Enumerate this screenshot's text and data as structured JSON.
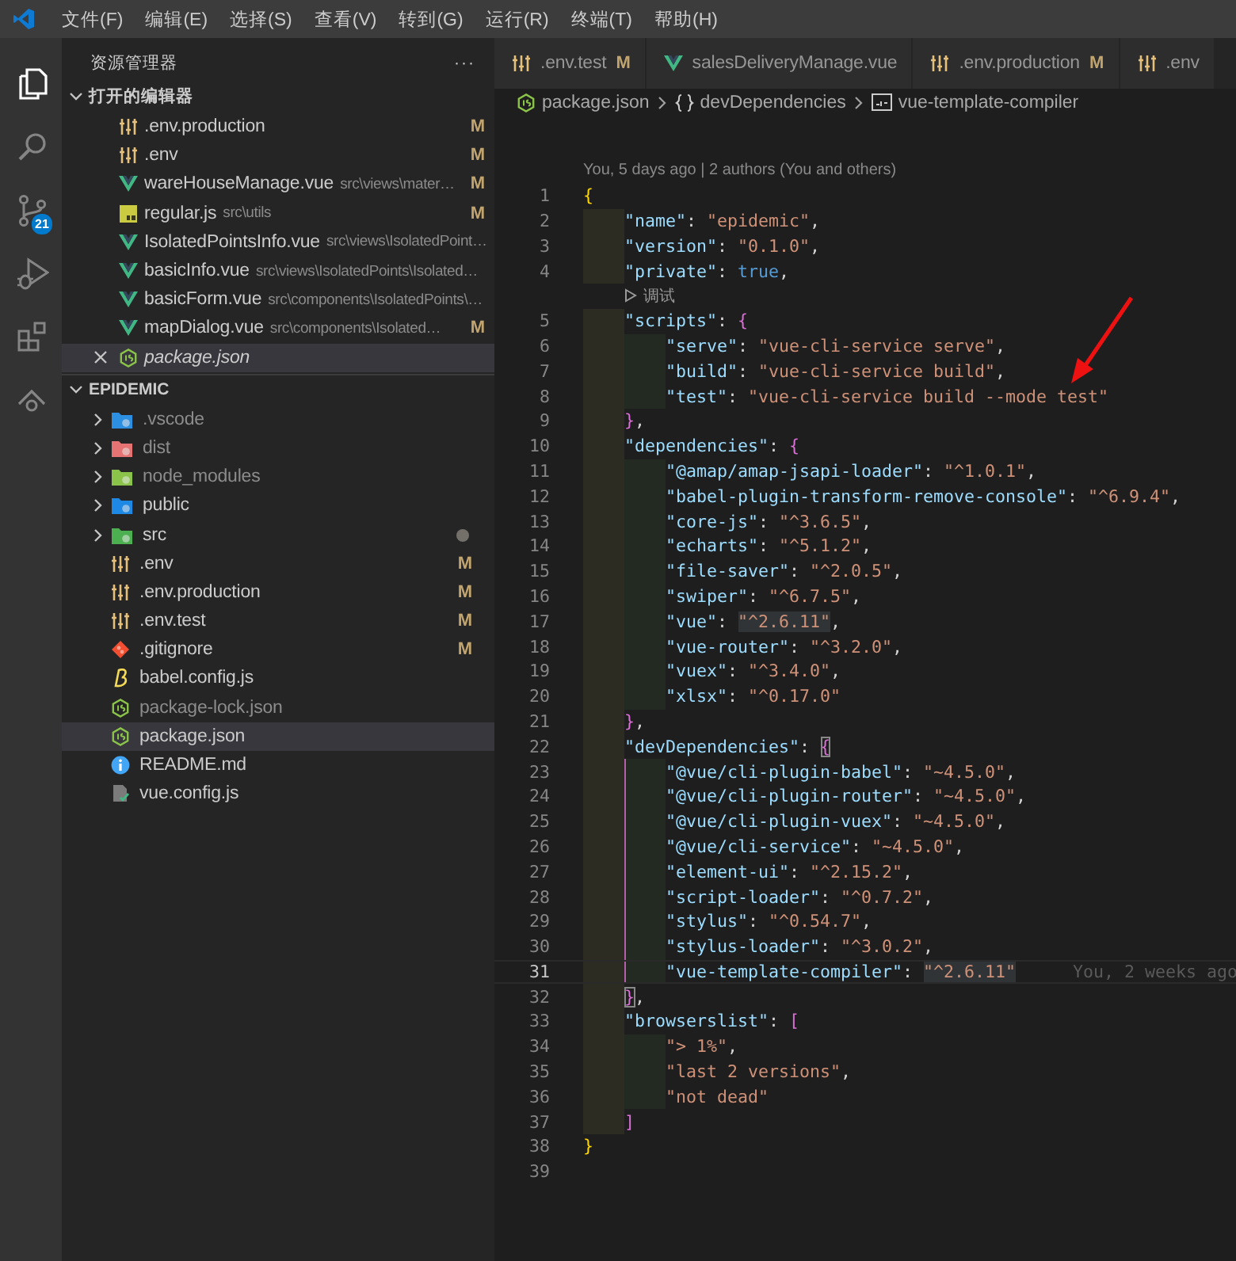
{
  "menu_bar": {
    "items": [
      "文件(F)",
      "编辑(E)",
      "选择(S)",
      "查看(V)",
      "转到(G)",
      "运行(R)",
      "终端(T)",
      "帮助(H)"
    ]
  },
  "activity_bar": {
    "items": [
      {
        "kind": "explorer",
        "selected": true
      },
      {
        "kind": "search",
        "selected": false
      },
      {
        "kind": "scm",
        "selected": false,
        "badge": "21"
      },
      {
        "kind": "debug",
        "selected": false
      },
      {
        "kind": "extensions",
        "selected": false
      },
      {
        "kind": "remote",
        "selected": false
      }
    ]
  },
  "sidebar": {
    "title": "资源管理器",
    "actions": "···",
    "open_editors": {
      "title": "打开的编辑器",
      "expanded": true,
      "items": [
        {
          "name": ".env.production",
          "kind": "env",
          "badge": "M",
          "selected": false,
          "preview": false
        },
        {
          "name": ".env",
          "kind": "env",
          "badge": "M",
          "selected": false,
          "preview": false
        },
        {
          "name": "wareHouseManage.vue",
          "description": "src\\views\\mater…",
          "kind": "vue",
          "badge": "M",
          "selected": false,
          "preview": false
        },
        {
          "name": "regular.js",
          "description": "src\\utils",
          "kind": "js",
          "badge": "M",
          "selected": false,
          "preview": false
        },
        {
          "name": "IsolatedPointsInfo.vue",
          "description": "src\\views\\IsolatedPoint…",
          "kind": "vue",
          "selected": false,
          "preview": false
        },
        {
          "name": "basicInfo.vue",
          "description": "src\\views\\IsolatedPoints\\Isolated…",
          "kind": "vue",
          "selected": false,
          "preview": false
        },
        {
          "name": "basicForm.vue",
          "description": "src\\components\\IsolatedPoints\\…",
          "kind": "vue",
          "selected": false,
          "preview": false
        },
        {
          "name": "mapDialog.vue",
          "description": "src\\components\\Isolated…",
          "kind": "vue",
          "badge": "M",
          "selected": false,
          "preview": false
        },
        {
          "name": "package.json",
          "kind": "json",
          "selected": true,
          "preview": true
        }
      ]
    },
    "folder": {
      "title": "EPIDEMIC",
      "expanded": true,
      "items": [
        {
          "kind": "vscodedir",
          "name": ".vscode",
          "expanded": false,
          "ignored": true,
          "selected": false,
          "changes_dot": false
        },
        {
          "kind": "distdir",
          "name": "dist",
          "expanded": false,
          "ignored": true,
          "selected": false,
          "changes_dot": false
        },
        {
          "kind": "nodedir",
          "name": "node_modules",
          "expanded": false,
          "ignored": true,
          "selected": false,
          "changes_dot": false
        },
        {
          "kind": "publicdir",
          "name": "public",
          "expanded": false,
          "ignored": false,
          "selected": false,
          "changes_dot": false
        },
        {
          "kind": "srcdir",
          "name": "src",
          "expanded": false,
          "ignored": false,
          "selected": false,
          "changes_dot": true
        },
        {
          "kind": "env",
          "name": ".env",
          "badge": "M",
          "ignored": false,
          "selected": false,
          "changes_dot": false
        },
        {
          "kind": "env",
          "name": ".env.production",
          "badge": "M",
          "ignored": false,
          "selected": false,
          "changes_dot": false
        },
        {
          "kind": "env",
          "name": ".env.test",
          "badge": "M",
          "ignored": false,
          "selected": false,
          "changes_dot": false
        },
        {
          "kind": "git",
          "name": ".gitignore",
          "badge": "M",
          "ignored": false,
          "selected": false,
          "changes_dot": false
        },
        {
          "kind": "babel",
          "name": "babel.config.js",
          "ignored": false,
          "selected": false,
          "changes_dot": false
        },
        {
          "kind": "json",
          "name": "package-lock.json",
          "ignored": true,
          "selected": false,
          "changes_dot": false
        },
        {
          "kind": "json",
          "name": "package.json",
          "ignored": false,
          "selected": true,
          "changes_dot": false
        },
        {
          "kind": "info",
          "name": "README.md",
          "ignored": false,
          "selected": false,
          "changes_dot": false
        },
        {
          "kind": "config",
          "name": "vue.config.js",
          "ignored": false,
          "selected": false,
          "changes_dot": false
        }
      ]
    }
  },
  "tabs": [
    {
      "label": ".env.test",
      "kind": "env",
      "badge": "M",
      "selected": false
    },
    {
      "label": "salesDeliveryManage.vue",
      "kind": "vue",
      "selected": false
    },
    {
      "label": ".env.production",
      "kind": "env",
      "badge": "M",
      "selected": false
    },
    {
      "label": ".env",
      "kind": "env",
      "selected": false
    }
  ],
  "breadcrumbs": [
    {
      "kind": "file",
      "label": "package.json"
    },
    {
      "kind": "object",
      "label": "devDependencies"
    },
    {
      "kind": "string",
      "label": "vue-template-compiler"
    }
  ],
  "editor": {
    "blame_header": "You, 5 days ago | 2 authors (You and others)",
    "lines": [
      {
        "kind": "code",
        "n": "1",
        "current": false,
        "tokens": [
          {
            "kind": "brace",
            "text": "{"
          }
        ],
        "children": [
          {
            "kind": "code",
            "n": "2",
            "current": false,
            "guide": false,
            "tokens": [
              {
                "kind": "key",
                "text": "\"name\""
              },
              {
                "kind": "punctuation",
                "text": ": "
              },
              {
                "kind": "string",
                "text": "\"epidemic\""
              },
              {
                "kind": "punctuation",
                "text": ","
              }
            ]
          },
          {
            "kind": "code",
            "n": "3",
            "current": false,
            "guide": false,
            "tokens": [
              {
                "kind": "key",
                "text": "\"version\""
              },
              {
                "kind": "punctuation",
                "text": ": "
              },
              {
                "kind": "string",
                "text": "\"0.1.0\""
              },
              {
                "kind": "punctuation",
                "text": ","
              }
            ]
          },
          {
            "kind": "code",
            "n": "4",
            "current": false,
            "guide": false,
            "tokens": [
              {
                "kind": "key",
                "text": "\"private\""
              },
              {
                "kind": "punctuation",
                "text": ": "
              },
              {
                "kind": "boolean",
                "text": "true"
              },
              {
                "kind": "punctuation",
                "text": ","
              }
            ]
          },
          {
            "kind": "codelens",
            "label": "调试"
          },
          {
            "kind": "code",
            "n": "5",
            "current": false,
            "guide": false,
            "tokens": [
              {
                "kind": "key",
                "text": "\"scripts\""
              },
              {
                "kind": "punctuation",
                "text": ": "
              },
              {
                "kind": "brace",
                "text": "{"
              }
            ],
            "children": [
              {
                "kind": "code",
                "n": "6",
                "current": false,
                "guide": false,
                "tokens": [
                  {
                    "kind": "key",
                    "text": "\"serve\""
                  },
                  {
                    "kind": "punctuation",
                    "text": ": "
                  },
                  {
                    "kind": "string",
                    "text": "\"vue-cli-service serve\""
                  },
                  {
                    "kind": "punctuation",
                    "text": ","
                  }
                ]
              },
              {
                "kind": "code",
                "n": "7",
                "current": false,
                "guide": false,
                "tokens": [
                  {
                    "kind": "key",
                    "text": "\"build\""
                  },
                  {
                    "kind": "punctuation",
                    "text": ": "
                  },
                  {
                    "kind": "string",
                    "text": "\"vue-cli-service build\""
                  },
                  {
                    "kind": "punctuation",
                    "text": ","
                  }
                ]
              },
              {
                "kind": "code",
                "n": "8",
                "current": false,
                "guide": false,
                "tokens": [
                  {
                    "kind": "key",
                    "text": "\"test\""
                  },
                  {
                    "kind": "punctuation",
                    "text": ": "
                  },
                  {
                    "kind": "string",
                    "text": "\"vue-cli-service build --mode test\""
                  }
                ]
              }
            ]
          },
          {
            "kind": "code",
            "n": "9",
            "current": false,
            "guide": false,
            "tokens": [
              {
                "kind": "brace",
                "text": "}"
              },
              {
                "kind": "punctuation",
                "text": ","
              }
            ]
          },
          {
            "kind": "code",
            "n": "10",
            "current": false,
            "guide": false,
            "tokens": [
              {
                "kind": "key",
                "text": "\"dependencies\""
              },
              {
                "kind": "punctuation",
                "text": ": "
              },
              {
                "kind": "brace",
                "text": "{"
              }
            ],
            "children": [
              {
                "kind": "code",
                "n": "11",
                "current": false,
                "guide": false,
                "tokens": [
                  {
                    "kind": "key",
                    "text": "\"@amap/amap-jsapi-loader\""
                  },
                  {
                    "kind": "punctuation",
                    "text": ": "
                  },
                  {
                    "kind": "string",
                    "text": "\"^1.0.1\""
                  },
                  {
                    "kind": "punctuation",
                    "text": ","
                  }
                ]
              },
              {
                "kind": "code",
                "n": "12",
                "current": false,
                "guide": false,
                "tokens": [
                  {
                    "kind": "key",
                    "text": "\"babel-plugin-transform-remove-console\""
                  },
                  {
                    "kind": "punctuation",
                    "text": ": "
                  },
                  {
                    "kind": "string",
                    "text": "\"^6.9.4\""
                  },
                  {
                    "kind": "punctuation",
                    "text": ","
                  }
                ]
              },
              {
                "kind": "code",
                "n": "13",
                "current": false,
                "guide": false,
                "tokens": [
                  {
                    "kind": "key",
                    "text": "\"core-js\""
                  },
                  {
                    "kind": "punctuation",
                    "text": ": "
                  },
                  {
                    "kind": "string",
                    "text": "\"^3.6.5\""
                  },
                  {
                    "kind": "punctuation",
                    "text": ","
                  }
                ]
              },
              {
                "kind": "code",
                "n": "14",
                "current": false,
                "guide": false,
                "tokens": [
                  {
                    "kind": "key",
                    "text": "\"echarts\""
                  },
                  {
                    "kind": "punctuation",
                    "text": ": "
                  },
                  {
                    "kind": "string",
                    "text": "\"^5.1.2\""
                  },
                  {
                    "kind": "punctuation",
                    "text": ","
                  }
                ]
              },
              {
                "kind": "code",
                "n": "15",
                "current": false,
                "guide": false,
                "tokens": [
                  {
                    "kind": "key",
                    "text": "\"file-saver\""
                  },
                  {
                    "kind": "punctuation",
                    "text": ": "
                  },
                  {
                    "kind": "string",
                    "text": "\"^2.0.5\""
                  },
                  {
                    "kind": "punctuation",
                    "text": ","
                  }
                ]
              },
              {
                "kind": "code",
                "n": "16",
                "current": false,
                "guide": false,
                "tokens": [
                  {
                    "kind": "key",
                    "text": "\"swiper\""
                  },
                  {
                    "kind": "punctuation",
                    "text": ": "
                  },
                  {
                    "kind": "string",
                    "text": "\"^6.7.5\""
                  },
                  {
                    "kind": "punctuation",
                    "text": ","
                  }
                ]
              },
              {
                "kind": "code",
                "n": "17",
                "current": false,
                "guide": false,
                "tokens": [
                  {
                    "kind": "key",
                    "text": "\"vue\""
                  },
                  {
                    "kind": "punctuation",
                    "text": ": "
                  },
                  {
                    "kind": "highlight",
                    "text": "\"^2.6.11\""
                  },
                  {
                    "kind": "punctuation",
                    "text": ","
                  }
                ]
              },
              {
                "kind": "code",
                "n": "18",
                "current": false,
                "guide": false,
                "tokens": [
                  {
                    "kind": "key",
                    "text": "\"vue-router\""
                  },
                  {
                    "kind": "punctuation",
                    "text": ": "
                  },
                  {
                    "kind": "string",
                    "text": "\"^3.2.0\""
                  },
                  {
                    "kind": "punctuation",
                    "text": ","
                  }
                ]
              },
              {
                "kind": "code",
                "n": "19",
                "current": false,
                "guide": false,
                "tokens": [
                  {
                    "kind": "key",
                    "text": "\"vuex\""
                  },
                  {
                    "kind": "punctuation",
                    "text": ": "
                  },
                  {
                    "kind": "string",
                    "text": "\"^3.4.0\""
                  },
                  {
                    "kind": "punctuation",
                    "text": ","
                  }
                ]
              },
              {
                "kind": "code",
                "n": "20",
                "current": false,
                "guide": false,
                "tokens": [
                  {
                    "kind": "key",
                    "text": "\"xlsx\""
                  },
                  {
                    "kind": "punctuation",
                    "text": ": "
                  },
                  {
                    "kind": "string",
                    "text": "\"^0.17.0\""
                  }
                ]
              }
            ]
          },
          {
            "kind": "code",
            "n": "21",
            "current": false,
            "guide": false,
            "tokens": [
              {
                "kind": "brace",
                "text": "}"
              },
              {
                "kind": "punctuation",
                "text": ","
              }
            ]
          },
          {
            "kind": "code",
            "n": "22",
            "current": false,
            "guide": false,
            "tokens": [
              {
                "kind": "key",
                "text": "\"devDependencies\""
              },
              {
                "kind": "punctuation",
                "text": ": "
              },
              {
                "kind": "match",
                "text": "{"
              }
            ],
            "children": [
              {
                "kind": "code",
                "n": "23",
                "current": false,
                "guide": true,
                "tokens": [
                  {
                    "kind": "key",
                    "text": "\"@vue/cli-plugin-babel\""
                  },
                  {
                    "kind": "punctuation",
                    "text": ": "
                  },
                  {
                    "kind": "string",
                    "text": "\"~4.5.0\""
                  },
                  {
                    "kind": "punctuation",
                    "text": ","
                  }
                ]
              },
              {
                "kind": "code",
                "n": "24",
                "current": false,
                "guide": true,
                "tokens": [
                  {
                    "kind": "key",
                    "text": "\"@vue/cli-plugin-router\""
                  },
                  {
                    "kind": "punctuation",
                    "text": ": "
                  },
                  {
                    "kind": "string",
                    "text": "\"~4.5.0\""
                  },
                  {
                    "kind": "punctuation",
                    "text": ","
                  }
                ]
              },
              {
                "kind": "code",
                "n": "25",
                "current": false,
                "guide": true,
                "tokens": [
                  {
                    "kind": "key",
                    "text": "\"@vue/cli-plugin-vuex\""
                  },
                  {
                    "kind": "punctuation",
                    "text": ": "
                  },
                  {
                    "kind": "string",
                    "text": "\"~4.5.0\""
                  },
                  {
                    "kind": "punctuation",
                    "text": ","
                  }
                ]
              },
              {
                "kind": "code",
                "n": "26",
                "current": false,
                "guide": true,
                "tokens": [
                  {
                    "kind": "key",
                    "text": "\"@vue/cli-service\""
                  },
                  {
                    "kind": "punctuation",
                    "text": ": "
                  },
                  {
                    "kind": "string",
                    "text": "\"~4.5.0\""
                  },
                  {
                    "kind": "punctuation",
                    "text": ","
                  }
                ]
              },
              {
                "kind": "code",
                "n": "27",
                "current": false,
                "guide": true,
                "tokens": [
                  {
                    "kind": "key",
                    "text": "\"element-ui\""
                  },
                  {
                    "kind": "punctuation",
                    "text": ": "
                  },
                  {
                    "kind": "string",
                    "text": "\"^2.15.2\""
                  },
                  {
                    "kind": "punctuation",
                    "text": ","
                  }
                ]
              },
              {
                "kind": "code",
                "n": "28",
                "current": false,
                "guide": true,
                "tokens": [
                  {
                    "kind": "key",
                    "text": "\"script-loader\""
                  },
                  {
                    "kind": "punctuation",
                    "text": ": "
                  },
                  {
                    "kind": "string",
                    "text": "\"^0.7.2\""
                  },
                  {
                    "kind": "punctuation",
                    "text": ","
                  }
                ]
              },
              {
                "kind": "code",
                "n": "29",
                "current": false,
                "guide": true,
                "tokens": [
                  {
                    "kind": "key",
                    "text": "\"stylus\""
                  },
                  {
                    "kind": "punctuation",
                    "text": ": "
                  },
                  {
                    "kind": "string",
                    "text": "\"^0.54.7\""
                  },
                  {
                    "kind": "punctuation",
                    "text": ","
                  }
                ]
              },
              {
                "kind": "code",
                "n": "30",
                "current": false,
                "guide": true,
                "tokens": [
                  {
                    "kind": "key",
                    "text": "\"stylus-loader\""
                  },
                  {
                    "kind": "punctuation",
                    "text": ": "
                  },
                  {
                    "kind": "string",
                    "text": "\"^3.0.2\""
                  },
                  {
                    "kind": "punctuation",
                    "text": ","
                  }
                ]
              },
              {
                "kind": "code",
                "n": "31",
                "current": true,
                "guide": true,
                "tokens": [
                  {
                    "kind": "key",
                    "text": "\"vue-template-compiler\""
                  },
                  {
                    "kind": "punctuation",
                    "text": ": "
                  },
                  {
                    "kind": "highlight",
                    "text": "\"^2.6.11\""
                  }
                ],
                "blame": "You, 2 weeks ago"
              }
            ]
          },
          {
            "kind": "code",
            "n": "32",
            "current": false,
            "guide": false,
            "tokens": [
              {
                "kind": "match",
                "text": "}"
              },
              {
                "kind": "punctuation",
                "text": ","
              }
            ]
          },
          {
            "kind": "code",
            "n": "33",
            "current": false,
            "guide": false,
            "tokens": [
              {
                "kind": "key",
                "text": "\"browserslist\""
              },
              {
                "kind": "punctuation",
                "text": ": "
              },
              {
                "kind": "brace",
                "text": "["
              }
            ],
            "children": [
              {
                "kind": "code",
                "n": "34",
                "current": false,
                "guide": false,
                "tokens": [
                  {
                    "kind": "string",
                    "text": "\"> 1%\""
                  },
                  {
                    "kind": "punctuation",
                    "text": ","
                  }
                ]
              },
              {
                "kind": "code",
                "n": "35",
                "current": false,
                "guide": false,
                "tokens": [
                  {
                    "kind": "string",
                    "text": "\"last 2 versions\""
                  },
                  {
                    "kind": "punctuation",
                    "text": ","
                  }
                ]
              },
              {
                "kind": "code",
                "n": "36",
                "current": false,
                "guide": false,
                "tokens": [
                  {
                    "kind": "string",
                    "text": "\"not dead\""
                  }
                ]
              }
            ]
          },
          {
            "kind": "code",
            "n": "37",
            "current": false,
            "guide": false,
            "tokens": [
              {
                "kind": "brace",
                "text": "]"
              }
            ]
          }
        ]
      },
      {
        "kind": "code",
        "n": "38",
        "current": false,
        "tokens": [
          {
            "kind": "brace",
            "text": "}"
          }
        ]
      },
      {
        "kind": "code",
        "n": "39",
        "current": false
      }
    ]
  }
}
